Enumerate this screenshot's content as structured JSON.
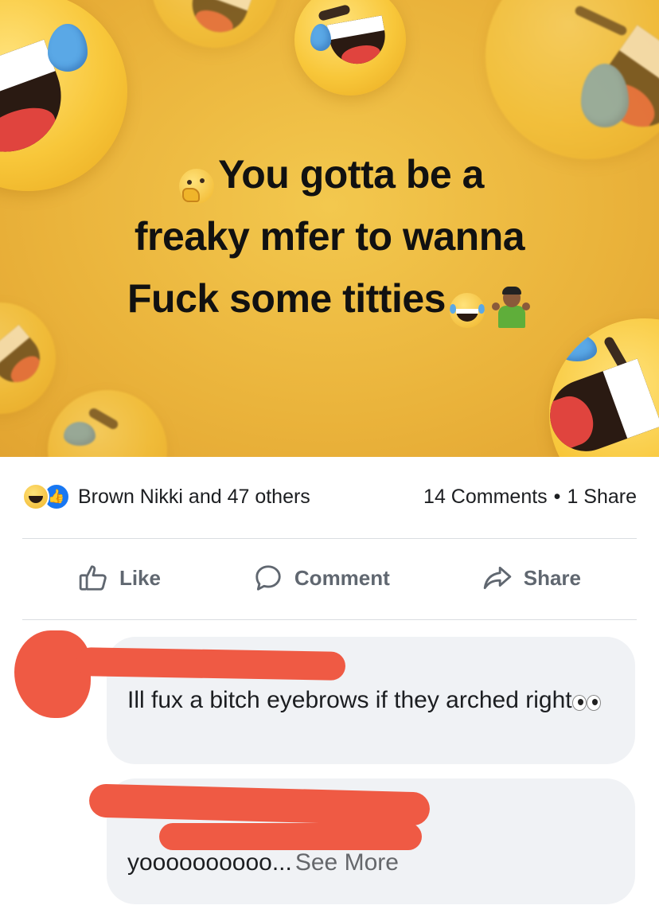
{
  "post": {
    "text_lines": [
      "You gotta be a",
      "freaky mfer to wanna",
      "Fuck some titties"
    ]
  },
  "summary": {
    "reactors": "Brown Nikki and 47 others",
    "comments": "14 Comments",
    "dot": "•",
    "shares": "1 Share"
  },
  "actions": {
    "like": "Like",
    "comment": "Comment",
    "share": "Share"
  },
  "comments": [
    {
      "text": "Ill fux a bitch eyebrows if they arched right"
    },
    {
      "text": "yoooooooooo...",
      "see_more": "See More"
    }
  ],
  "icons": [
    "thinking-face-icon",
    "rolling-laughing-icon",
    "shrug-icon",
    "haha-reaction-icon",
    "like-reaction-icon",
    "thumbs-up-icon",
    "comment-bubble-icon",
    "share-arrow-icon",
    "eyes-icon"
  ],
  "colors": {
    "background_yellow": "#eab33b",
    "redaction": "#ef5a44",
    "facebook_blue": "#1877f2",
    "comment_bubble": "#f0f2f5",
    "action_gray": "#606770"
  }
}
